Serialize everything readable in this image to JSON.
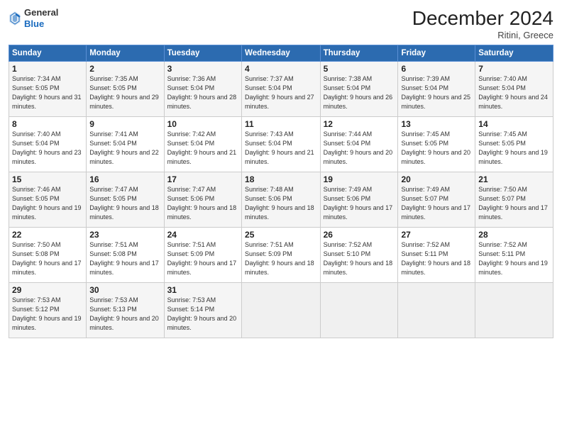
{
  "header": {
    "logo_general": "General",
    "logo_blue": "Blue",
    "month_title": "December 2024",
    "location": "Ritini, Greece"
  },
  "days_of_week": [
    "Sunday",
    "Monday",
    "Tuesday",
    "Wednesday",
    "Thursday",
    "Friday",
    "Saturday"
  ],
  "weeks": [
    [
      {
        "day": "1",
        "sunrise": "7:34 AM",
        "sunset": "5:05 PM",
        "daylight": "9 hours and 31 minutes."
      },
      {
        "day": "2",
        "sunrise": "7:35 AM",
        "sunset": "5:05 PM",
        "daylight": "9 hours and 29 minutes."
      },
      {
        "day": "3",
        "sunrise": "7:36 AM",
        "sunset": "5:04 PM",
        "daylight": "9 hours and 28 minutes."
      },
      {
        "day": "4",
        "sunrise": "7:37 AM",
        "sunset": "5:04 PM",
        "daylight": "9 hours and 27 minutes."
      },
      {
        "day": "5",
        "sunrise": "7:38 AM",
        "sunset": "5:04 PM",
        "daylight": "9 hours and 26 minutes."
      },
      {
        "day": "6",
        "sunrise": "7:39 AM",
        "sunset": "5:04 PM",
        "daylight": "9 hours and 25 minutes."
      },
      {
        "day": "7",
        "sunrise": "7:40 AM",
        "sunset": "5:04 PM",
        "daylight": "9 hours and 24 minutes."
      }
    ],
    [
      {
        "day": "8",
        "sunrise": "7:40 AM",
        "sunset": "5:04 PM",
        "daylight": "9 hours and 23 minutes."
      },
      {
        "day": "9",
        "sunrise": "7:41 AM",
        "sunset": "5:04 PM",
        "daylight": "9 hours and 22 minutes."
      },
      {
        "day": "10",
        "sunrise": "7:42 AM",
        "sunset": "5:04 PM",
        "daylight": "9 hours and 21 minutes."
      },
      {
        "day": "11",
        "sunrise": "7:43 AM",
        "sunset": "5:04 PM",
        "daylight": "9 hours and 21 minutes."
      },
      {
        "day": "12",
        "sunrise": "7:44 AM",
        "sunset": "5:04 PM",
        "daylight": "9 hours and 20 minutes."
      },
      {
        "day": "13",
        "sunrise": "7:45 AM",
        "sunset": "5:05 PM",
        "daylight": "9 hours and 20 minutes."
      },
      {
        "day": "14",
        "sunrise": "7:45 AM",
        "sunset": "5:05 PM",
        "daylight": "9 hours and 19 minutes."
      }
    ],
    [
      {
        "day": "15",
        "sunrise": "7:46 AM",
        "sunset": "5:05 PM",
        "daylight": "9 hours and 19 minutes."
      },
      {
        "day": "16",
        "sunrise": "7:47 AM",
        "sunset": "5:05 PM",
        "daylight": "9 hours and 18 minutes."
      },
      {
        "day": "17",
        "sunrise": "7:47 AM",
        "sunset": "5:06 PM",
        "daylight": "9 hours and 18 minutes."
      },
      {
        "day": "18",
        "sunrise": "7:48 AM",
        "sunset": "5:06 PM",
        "daylight": "9 hours and 18 minutes."
      },
      {
        "day": "19",
        "sunrise": "7:49 AM",
        "sunset": "5:06 PM",
        "daylight": "9 hours and 17 minutes."
      },
      {
        "day": "20",
        "sunrise": "7:49 AM",
        "sunset": "5:07 PM",
        "daylight": "9 hours and 17 minutes."
      },
      {
        "day": "21",
        "sunrise": "7:50 AM",
        "sunset": "5:07 PM",
        "daylight": "9 hours and 17 minutes."
      }
    ],
    [
      {
        "day": "22",
        "sunrise": "7:50 AM",
        "sunset": "5:08 PM",
        "daylight": "9 hours and 17 minutes."
      },
      {
        "day": "23",
        "sunrise": "7:51 AM",
        "sunset": "5:08 PM",
        "daylight": "9 hours and 17 minutes."
      },
      {
        "day": "24",
        "sunrise": "7:51 AM",
        "sunset": "5:09 PM",
        "daylight": "9 hours and 17 minutes."
      },
      {
        "day": "25",
        "sunrise": "7:51 AM",
        "sunset": "5:09 PM",
        "daylight": "9 hours and 18 minutes."
      },
      {
        "day": "26",
        "sunrise": "7:52 AM",
        "sunset": "5:10 PM",
        "daylight": "9 hours and 18 minutes."
      },
      {
        "day": "27",
        "sunrise": "7:52 AM",
        "sunset": "5:11 PM",
        "daylight": "9 hours and 18 minutes."
      },
      {
        "day": "28",
        "sunrise": "7:52 AM",
        "sunset": "5:11 PM",
        "daylight": "9 hours and 19 minutes."
      }
    ],
    [
      {
        "day": "29",
        "sunrise": "7:53 AM",
        "sunset": "5:12 PM",
        "daylight": "9 hours and 19 minutes."
      },
      {
        "day": "30",
        "sunrise": "7:53 AM",
        "sunset": "5:13 PM",
        "daylight": "9 hours and 20 minutes."
      },
      {
        "day": "31",
        "sunrise": "7:53 AM",
        "sunset": "5:14 PM",
        "daylight": "9 hours and 20 minutes."
      },
      null,
      null,
      null,
      null
    ]
  ]
}
